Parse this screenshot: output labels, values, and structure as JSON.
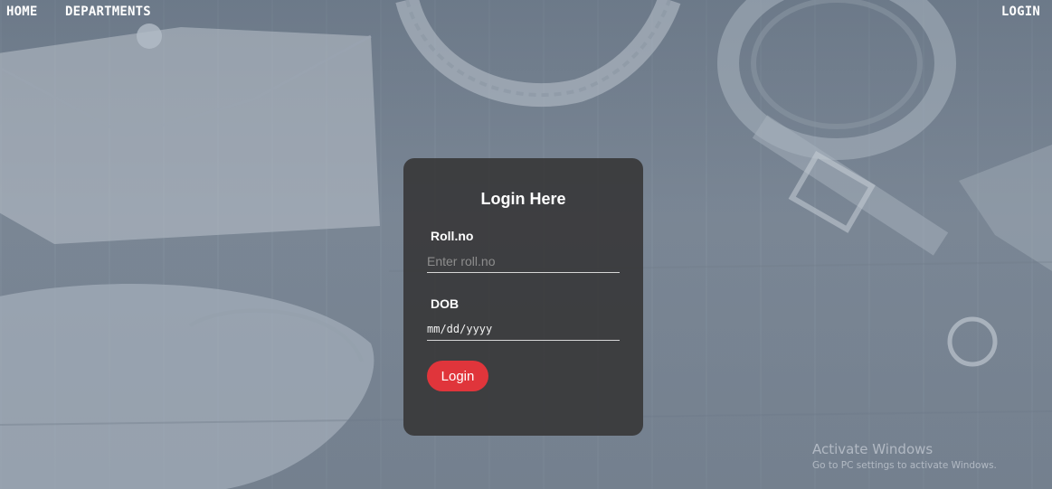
{
  "nav": {
    "home": "HOME",
    "departments": "DEPARTMENTS",
    "login": "LOGIN"
  },
  "login_form": {
    "title": "Login Here",
    "rollno_label": "Roll.no",
    "rollno_placeholder": "Enter roll.no",
    "rollno_value": "",
    "dob_label": "DOB",
    "dob_placeholder": "mm/dd/yyyy",
    "dob_value": "",
    "submit_label": "Login"
  },
  "watermark": {
    "line1": "Activate Windows",
    "line2": "Go to PC settings to activate Windows."
  },
  "colors": {
    "card_bg": "#38383a",
    "button": "#e0353b",
    "text": "#ffffff"
  }
}
